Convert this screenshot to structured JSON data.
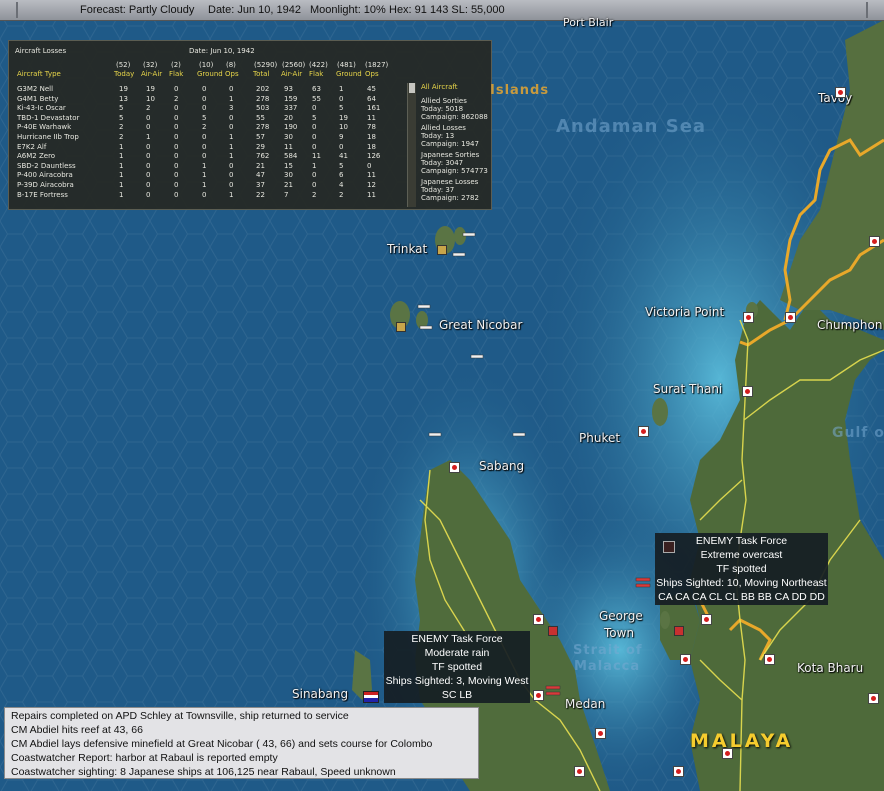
{
  "status_bar": {
    "forecast": "Forecast: Partly Cloudy",
    "date": "Date: Jun 10, 1942",
    "moonlight": "Moonlight: 10%",
    "hex": "Hex: 91 143  SL: 55,000"
  },
  "aircraft_losses": {
    "title": "Aircraft Losses",
    "date": "Date: Jun 10, 1942",
    "header_counts": [
      "(52)",
      "(32)",
      "(2)",
      "(10)",
      "(8)",
      "(5290)",
      "(2560)",
      "(422)",
      "(481)",
      "(1827)"
    ],
    "header_labels": [
      "Aircraft Type",
      "Today",
      "Air-Air",
      "Flak",
      "Ground",
      "Ops",
      "Total",
      "Air-Air",
      "Flak",
      "Ground",
      "Ops"
    ],
    "rows": [
      [
        "G3M2 Nell",
        "19",
        "19",
        "0",
        "0",
        "0",
        "202",
        "93",
        "63",
        "1",
        "45"
      ],
      [
        "G4M1 Betty",
        "13",
        "10",
        "2",
        "0",
        "1",
        "278",
        "159",
        "55",
        "0",
        "64"
      ],
      [
        "Ki-43-Ic Oscar",
        "5",
        "2",
        "0",
        "0",
        "3",
        "503",
        "337",
        "0",
        "5",
        "161"
      ],
      [
        "TBD-1 Devastator",
        "5",
        "0",
        "0",
        "5",
        "0",
        "55",
        "20",
        "5",
        "19",
        "11"
      ],
      [
        "P-40E Warhawk",
        "2",
        "0",
        "0",
        "2",
        "0",
        "278",
        "190",
        "0",
        "10",
        "78"
      ],
      [
        "Hurricane IIb Trop",
        "2",
        "1",
        "0",
        "0",
        "1",
        "57",
        "30",
        "0",
        "9",
        "18"
      ],
      [
        "E7K2 Alf",
        "1",
        "0",
        "0",
        "0",
        "1",
        "29",
        "11",
        "0",
        "0",
        "18"
      ],
      [
        "A6M2 Zero",
        "1",
        "0",
        "0",
        "0",
        "1",
        "762",
        "584",
        "11",
        "41",
        "126"
      ],
      [
        "SBD-2 Dauntless",
        "1",
        "0",
        "0",
        "1",
        "0",
        "21",
        "15",
        "1",
        "5",
        "0"
      ],
      [
        "P-400 Airacobra",
        "1",
        "0",
        "0",
        "1",
        "0",
        "47",
        "30",
        "0",
        "6",
        "11"
      ],
      [
        "P-39D Airacobra",
        "1",
        "0",
        "0",
        "1",
        "0",
        "37",
        "21",
        "0",
        "4",
        "12"
      ],
      [
        "B-17E Fortress",
        "1",
        "0",
        "0",
        "0",
        "1",
        "22",
        "7",
        "2",
        "2",
        "11"
      ]
    ],
    "side": {
      "filter": "All Aircraft",
      "allied_sorties_label": "Allied Sorties",
      "allied_sorties_today": "Today:   5018",
      "allied_sorties_campaign": "Campaign: 862088",
      "allied_losses_label": "Allied Losses",
      "allied_losses_today": "Today:   13",
      "allied_losses_campaign": "Campaign: 1947",
      "japanese_sorties_label": "Japanese Sorties",
      "japanese_sorties_today": "Today:   3047",
      "japanese_sorties_campaign": "Campaign: 574773",
      "japanese_losses_label": "Japanese Losses",
      "japanese_losses_today": "Today:   37",
      "japanese_losses_campaign": "Campaign: 2782"
    }
  },
  "map_labels": {
    "port_blair": "Port Blair",
    "islands": "Islands",
    "andaman_sea": "Andaman Sea",
    "tavoy": "Tavoy",
    "trinkat": "Trinkat",
    "great_nicobar": "Great Nicobar",
    "victoria_point": "Victoria Point",
    "chumphon": "Chumphon",
    "surat_thani": "Surat Thani",
    "gulf": "Gulf o",
    "phuket": "Phuket",
    "sabang": "Sabang",
    "george_town_1": "George",
    "george_town_2": "Town",
    "strait_1": "Strait of",
    "strait_2": "Malacca",
    "kota_bharu": "Kota Bharu",
    "sinabang": "Sinabang",
    "medan": "Medan",
    "malaya": "MALAYA"
  },
  "task_forces": [
    {
      "title": "ENEMY Task Force",
      "weather": "Extreme overcast",
      "status": "TF spotted",
      "sighted": "Ships Sighted: 10, Moving Northeast",
      "ships": "CA CA CA CL CL BB BB CA DD DD"
    },
    {
      "title": "ENEMY Task Force",
      "weather": "Moderate rain",
      "status": "TF spotted",
      "sighted": "Ships Sighted: 3, Moving West",
      "ships": "SC LB"
    }
  ],
  "messages": [
    "Repairs completed on APD Schley at Townsville, ship returned to service",
    "CM Abdiel hits reef at 43, 66",
    "CM Abdiel lays defensive minefield at Great Nicobar ( 43, 66) and sets course for Colombo",
    "Coastwatcher Report: harbor at Rabaul is reported empty",
    "Coastwatcher sighting: 8 Japanese ships at 106,125 near Rabaul, Speed unknown"
  ],
  "colors": {
    "ocean": "#1e5a86",
    "land": "#4e6a3a",
    "coast_ocean": "#3fa0c8",
    "hex_border": "#e8a82a",
    "road": "#e8e050",
    "panel_header": "#e8d64a",
    "japanese_base": "#d41e1e"
  }
}
